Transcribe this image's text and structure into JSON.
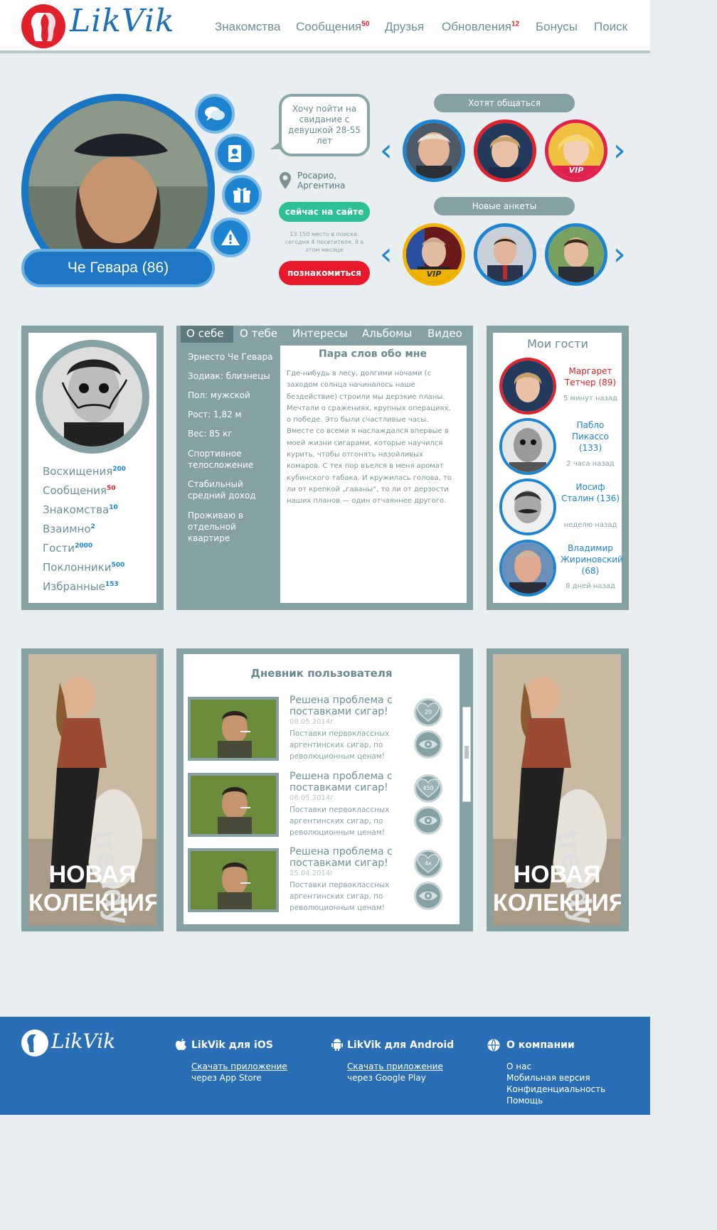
{
  "header": {
    "logo_text": "LikVik",
    "nav": [
      {
        "label": "Знакомства",
        "badge": ""
      },
      {
        "label": "Сообщения",
        "badge": "50"
      },
      {
        "label": "Друзья",
        "badge": ""
      },
      {
        "label": "Обновления",
        "badge": "12"
      },
      {
        "label": "Бонусы",
        "badge": ""
      },
      {
        "label": "Поиск",
        "badge": ""
      }
    ]
  },
  "profile": {
    "name": "Че Гевара (86)",
    "status_bubble": "Хочу пойти на свидание с девушкой 28-55 лет",
    "location": "Росарио, Аргентина",
    "online_label": "сейчас на сайте",
    "stats": "13 150 место в поиске. сегодня 4 посетителя, 9 в этом месяце",
    "meet_label": "познакомиться",
    "side_buttons": [
      "chat-icon",
      "contacts-icon",
      "gift-icon",
      "warning-icon"
    ]
  },
  "want_to_chat": {
    "title": "Хотят общаться",
    "vip_label": "VIP"
  },
  "new_profiles": {
    "title": "Новые анкеты",
    "vip_label": "VIP"
  },
  "counters": {
    "items": [
      {
        "label": "Восхищения",
        "badge": "200"
      },
      {
        "label": "Сообщения",
        "badge": "50"
      },
      {
        "label": "Знакомства",
        "badge": "10"
      },
      {
        "label": "Взаимно",
        "badge": "2"
      },
      {
        "label": "Гости",
        "badge": "2000"
      },
      {
        "label": "Поклонники",
        "badge": "500"
      },
      {
        "label": "Избранные",
        "badge": "153"
      }
    ]
  },
  "tabs": [
    "О себе",
    "О тебе",
    "Интересы",
    "Альбомы",
    "Видео"
  ],
  "facts": [
    "Эрнесто Че Гевара",
    "Зодиак: близнецы",
    "Пол: мужской",
    "Рост: 1,82 м",
    "Вес: 85 кг",
    "Спортивное телосложение",
    "Стабильный средний доход",
    "Проживаю в отдельной квартире"
  ],
  "about": {
    "title": "Пара слов обо мне",
    "text": "Где-нибудь в лесу, долгими ночами (с заходом солнца начиналось наше бездействие) строили мы дерзкие планы. Мечтали о сражениях, крупных операциях, о победе. Это были счастливые часы. Вместе со всеми я наслаждался впервые в моей жизни сигарами, которые научился курить, чтобы отгонять назойливых комаров. С тех пор въелся в меня аромат кубинского табака. И кружилась голова, то ли от крепкой „гаваны“, то ли от дерзости наших планов — один отчаяннее другого."
  },
  "guests": {
    "title": "Мои гости",
    "items": [
      {
        "name": "Маргарет Тетчер (89)",
        "time": "5 минут назад",
        "color": "#e0202a"
      },
      {
        "name": "Пабло Пикассо (133)",
        "time": "2 часа назад",
        "color": "#1e84d0"
      },
      {
        "name": "Иосиф Сталин (136)",
        "time": "неделю назад",
        "color": "#1e84d0"
      },
      {
        "name": "Владимир Жириновский (68)",
        "time": "8 дней назад",
        "color": "#1e84d0"
      }
    ]
  },
  "ad": {
    "line1": "НОВАЯ",
    "line2": "КОЛЕКЦИЯ!",
    "brand": "trendy"
  },
  "diary": {
    "title": "Дневник пользователя",
    "posts": [
      {
        "title": "Решена проблема с поставками сигар!",
        "date": "08.05.2014г",
        "text": "Поставки первоклассных аргентинских сигар, по революционным ценам!",
        "likes": "20"
      },
      {
        "title": "Решена проблема с поставками сигар!",
        "date": "06.05.2014г",
        "text": "Поставки первоклассных аргентинских сигар, по революционным ценам!",
        "likes": "450"
      },
      {
        "title": "Решена проблема с поставками сигар!",
        "date": "25.04.2014г",
        "text": "Поставки первоклассных аргентинских сигар, по революционным ценам!",
        "likes": "4к"
      }
    ]
  },
  "footer": {
    "logo_text": "LikVik",
    "ios": {
      "title": "LikVik для iOS",
      "link": "Скачать приложение",
      "sub": "через App Store"
    },
    "android": {
      "title": "LikVik для Android",
      "link": "Скачать приложение",
      "sub": "через Google Play"
    },
    "company": {
      "title": "О компании",
      "links": [
        "О нас",
        "Мобильная версия",
        "Конфиденциальность",
        "Помощь"
      ]
    }
  },
  "colors": {
    "accent_blue": "#1e84d0",
    "accent_red": "#e0202a",
    "panel_gray": "#86a1a4",
    "online_green": "#2dbf95",
    "footer_blue": "#2a6fb6"
  }
}
